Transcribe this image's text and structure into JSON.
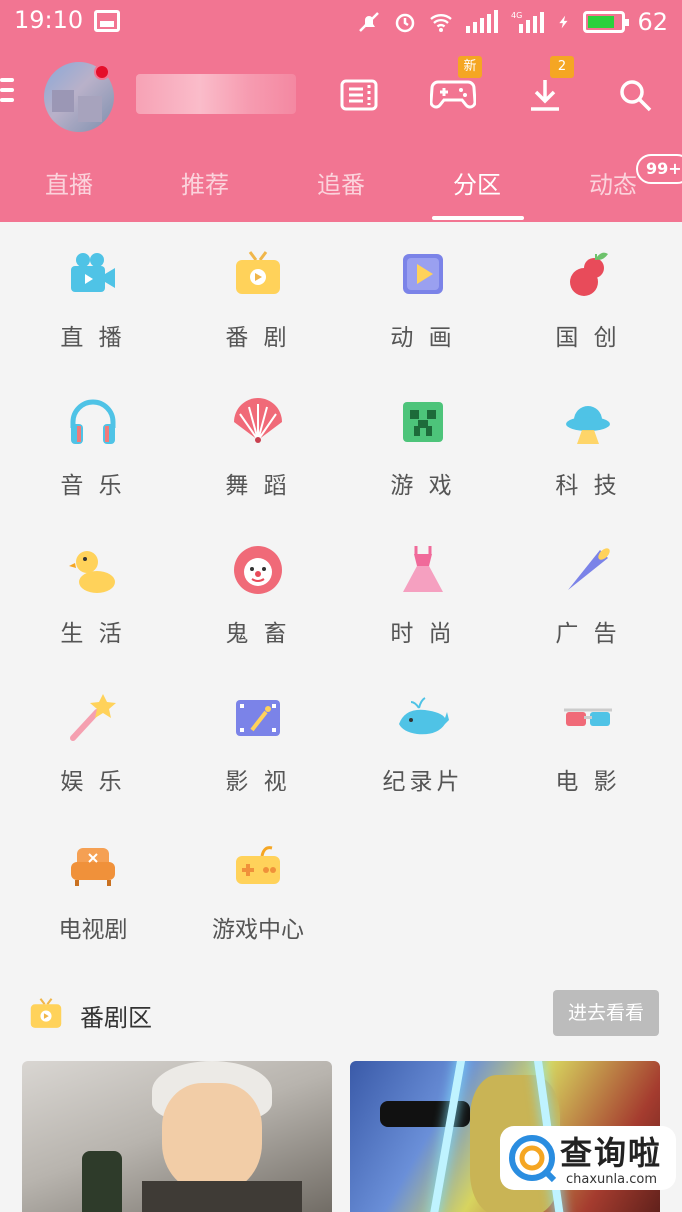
{
  "status_bar": {
    "time": "19:10",
    "battery_percent": "62",
    "network": "4G",
    "icons": [
      "image-icon",
      "mute-icon",
      "alarm-icon",
      "wifi-icon",
      "signal-icon",
      "signal-4g-icon",
      "charging-icon",
      "battery-icon"
    ],
    "battery_color": "#2bd13c"
  },
  "toolbar": {
    "menu_icon": "menu-icon",
    "avatar_badge_color": "#e50e2a",
    "buttons": [
      {
        "name": "coupon-icon",
        "badge": ""
      },
      {
        "name": "game-controller-icon",
        "badge": "新"
      },
      {
        "name": "download-icon",
        "badge": "2"
      },
      {
        "name": "search-icon",
        "badge": ""
      }
    ]
  },
  "tabs": {
    "items": [
      "直播",
      "推荐",
      "追番",
      "分区",
      "动态"
    ],
    "active_index": 3,
    "badge": "99+"
  },
  "categories": [
    {
      "label": "直 播",
      "icon": "live-camera-icon"
    },
    {
      "label": "番 剧",
      "icon": "tv-icon"
    },
    {
      "label": "动 画",
      "icon": "animation-icon"
    },
    {
      "label": "国 创",
      "icon": "gourd-icon"
    },
    {
      "label": "音 乐",
      "icon": "headphones-icon"
    },
    {
      "label": "舞 蹈",
      "icon": "fan-icon"
    },
    {
      "label": "游 戏",
      "icon": "creeper-icon"
    },
    {
      "label": "科 技",
      "icon": "ufo-icon"
    },
    {
      "label": "生 活",
      "icon": "duck-icon"
    },
    {
      "label": "鬼 畜",
      "icon": "clown-icon"
    },
    {
      "label": "时 尚",
      "icon": "dress-icon"
    },
    {
      "label": "广 告",
      "icon": "megaphone-icon"
    },
    {
      "label": "娱 乐",
      "icon": "magic-wand-icon"
    },
    {
      "label": "影 视",
      "icon": "film-icon"
    },
    {
      "label": "纪录片",
      "icon": "whale-icon"
    },
    {
      "label": "电 影",
      "icon": "3d-glasses-icon"
    },
    {
      "label": "电视剧",
      "icon": "sofa-icon"
    },
    {
      "label": "游戏中心",
      "icon": "gamepad-icon"
    }
  ],
  "section": {
    "title": "番剧区",
    "more_button": "进去看看",
    "icon": "tv-icon"
  },
  "watermark": {
    "text": "查询啦",
    "sub": "chaxunla.com"
  },
  "colors": {
    "header": "#f27592",
    "badge": "#f5a623"
  }
}
